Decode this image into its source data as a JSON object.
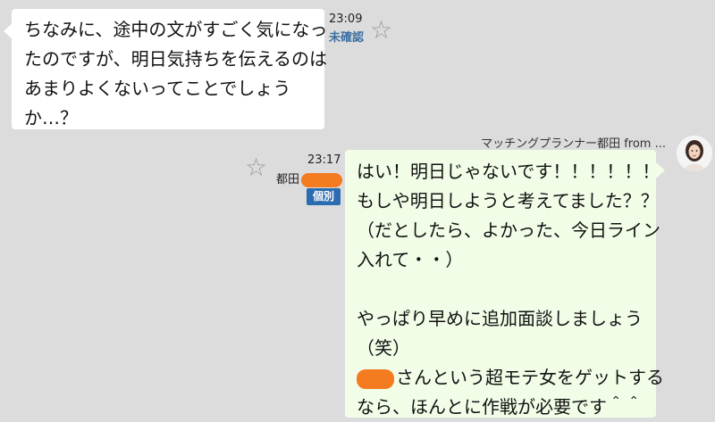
{
  "left_message": {
    "lines": [
      "ちなみに、途中の文がすごく気になっ",
      "たのですが、明日気持ちを伝えるのは",
      "あまりよくないってことでしょう",
      "か…？"
    ],
    "time": "23:09",
    "status": "未確認"
  },
  "right_message": {
    "sender": "マッチングプランナー都田 from ...",
    "time": "23:17",
    "staff_name": "都田",
    "badge": "個別",
    "lines": [
      "はい！明日じゃないです！！！！！！",
      "もしや明日しようと考えてました？？",
      "（だとしたら、よかった、今日ライン",
      "入れて・・）",
      "",
      "やっぱり早めに追加面談しましょう",
      "（笑）"
    ],
    "line_redacted_suffix": "さんという超モテ女をゲットする",
    "last_line": "なら、ほんとに作戦が必要です＾＾"
  },
  "icons": {
    "star": "star-icon",
    "avatar": "avatar"
  },
  "colors": {
    "background": "#dcdcdc",
    "left_bubble": "#ffffff",
    "right_bubble": "#f2fde8",
    "status": "#3b6fa1",
    "badge": "#2b6cb0",
    "redaction": "#f47b20"
  }
}
